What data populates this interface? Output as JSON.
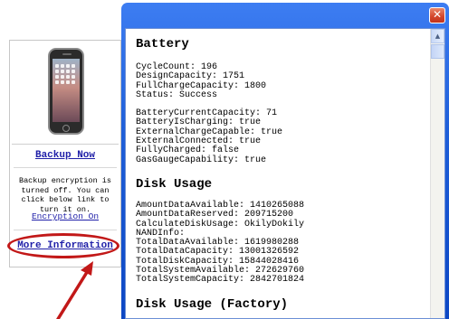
{
  "side_panel": {
    "backup_link": "Backup Now",
    "encryption_text": "Backup encryption is turned off. You can click below link to turn it on.",
    "encryption_link": "Encryption On",
    "more_info_link": "More Information"
  },
  "dialog": {
    "close_glyph": "✕",
    "scroll_up_glyph": "▲",
    "sections": [
      {
        "title": "Battery",
        "groups": [
          [
            "CycleCount: 196",
            "DesignCapacity: 1751",
            "FullChargeCapacity: 1800",
            "Status: Success"
          ],
          [
            "BatteryCurrentCapacity: 71",
            "BatteryIsCharging: true",
            "ExternalChargeCapable: true",
            "ExternalConnected: true",
            "FullyCharged: false",
            "GasGaugeCapability: true"
          ]
        ]
      },
      {
        "title": "Disk Usage",
        "groups": [
          [
            "AmountDataAvailable: 1410265088",
            "AmountDataReserved: 209715200",
            "CalculateDiskUsage: OkilyDokily",
            "NANDInfo:",
            "TotalDataAvailable: 1619980288",
            "TotalDataCapacity: 13001326592",
            "TotalDiskCapacity: 15844028416",
            "TotalSystemAvailable: 272629760",
            "TotalSystemCapacity: 2842701824"
          ]
        ]
      },
      {
        "title": "Disk Usage (Factory)",
        "groups": []
      }
    ]
  },
  "colors": {
    "link": "#1f1fa8",
    "annotation_red": "#c21818",
    "title_bar": "#1f5fd9"
  }
}
